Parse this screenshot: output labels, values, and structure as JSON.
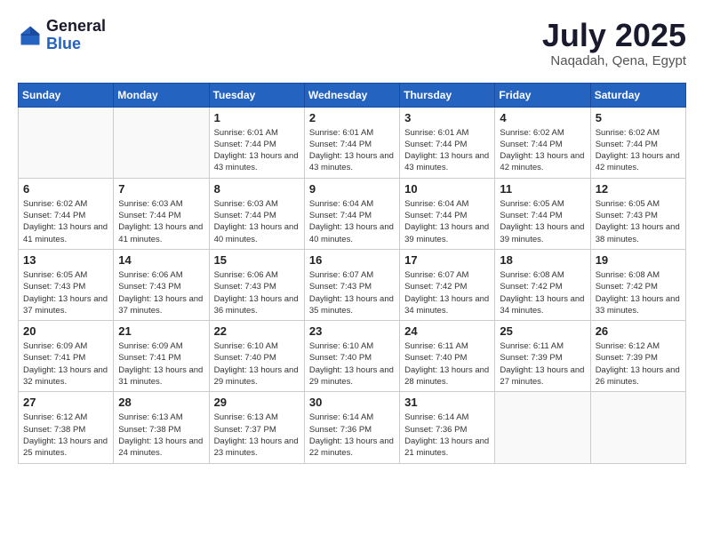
{
  "logo": {
    "general": "General",
    "blue": "Blue"
  },
  "title": "July 2025",
  "location": "Naqadah, Qena, Egypt",
  "weekdays": [
    "Sunday",
    "Monday",
    "Tuesday",
    "Wednesday",
    "Thursday",
    "Friday",
    "Saturday"
  ],
  "weeks": [
    [
      {
        "day": null
      },
      {
        "day": null
      },
      {
        "day": 1,
        "sunrise": "Sunrise: 6:01 AM",
        "sunset": "Sunset: 7:44 PM",
        "daylight": "Daylight: 13 hours and 43 minutes."
      },
      {
        "day": 2,
        "sunrise": "Sunrise: 6:01 AM",
        "sunset": "Sunset: 7:44 PM",
        "daylight": "Daylight: 13 hours and 43 minutes."
      },
      {
        "day": 3,
        "sunrise": "Sunrise: 6:01 AM",
        "sunset": "Sunset: 7:44 PM",
        "daylight": "Daylight: 13 hours and 43 minutes."
      },
      {
        "day": 4,
        "sunrise": "Sunrise: 6:02 AM",
        "sunset": "Sunset: 7:44 PM",
        "daylight": "Daylight: 13 hours and 42 minutes."
      },
      {
        "day": 5,
        "sunrise": "Sunrise: 6:02 AM",
        "sunset": "Sunset: 7:44 PM",
        "daylight": "Daylight: 13 hours and 42 minutes."
      }
    ],
    [
      {
        "day": 6,
        "sunrise": "Sunrise: 6:02 AM",
        "sunset": "Sunset: 7:44 PM",
        "daylight": "Daylight: 13 hours and 41 minutes."
      },
      {
        "day": 7,
        "sunrise": "Sunrise: 6:03 AM",
        "sunset": "Sunset: 7:44 PM",
        "daylight": "Daylight: 13 hours and 41 minutes."
      },
      {
        "day": 8,
        "sunrise": "Sunrise: 6:03 AM",
        "sunset": "Sunset: 7:44 PM",
        "daylight": "Daylight: 13 hours and 40 minutes."
      },
      {
        "day": 9,
        "sunrise": "Sunrise: 6:04 AM",
        "sunset": "Sunset: 7:44 PM",
        "daylight": "Daylight: 13 hours and 40 minutes."
      },
      {
        "day": 10,
        "sunrise": "Sunrise: 6:04 AM",
        "sunset": "Sunset: 7:44 PM",
        "daylight": "Daylight: 13 hours and 39 minutes."
      },
      {
        "day": 11,
        "sunrise": "Sunrise: 6:05 AM",
        "sunset": "Sunset: 7:44 PM",
        "daylight": "Daylight: 13 hours and 39 minutes."
      },
      {
        "day": 12,
        "sunrise": "Sunrise: 6:05 AM",
        "sunset": "Sunset: 7:43 PM",
        "daylight": "Daylight: 13 hours and 38 minutes."
      }
    ],
    [
      {
        "day": 13,
        "sunrise": "Sunrise: 6:05 AM",
        "sunset": "Sunset: 7:43 PM",
        "daylight": "Daylight: 13 hours and 37 minutes."
      },
      {
        "day": 14,
        "sunrise": "Sunrise: 6:06 AM",
        "sunset": "Sunset: 7:43 PM",
        "daylight": "Daylight: 13 hours and 37 minutes."
      },
      {
        "day": 15,
        "sunrise": "Sunrise: 6:06 AM",
        "sunset": "Sunset: 7:43 PM",
        "daylight": "Daylight: 13 hours and 36 minutes."
      },
      {
        "day": 16,
        "sunrise": "Sunrise: 6:07 AM",
        "sunset": "Sunset: 7:43 PM",
        "daylight": "Daylight: 13 hours and 35 minutes."
      },
      {
        "day": 17,
        "sunrise": "Sunrise: 6:07 AM",
        "sunset": "Sunset: 7:42 PM",
        "daylight": "Daylight: 13 hours and 34 minutes."
      },
      {
        "day": 18,
        "sunrise": "Sunrise: 6:08 AM",
        "sunset": "Sunset: 7:42 PM",
        "daylight": "Daylight: 13 hours and 34 minutes."
      },
      {
        "day": 19,
        "sunrise": "Sunrise: 6:08 AM",
        "sunset": "Sunset: 7:42 PM",
        "daylight": "Daylight: 13 hours and 33 minutes."
      }
    ],
    [
      {
        "day": 20,
        "sunrise": "Sunrise: 6:09 AM",
        "sunset": "Sunset: 7:41 PM",
        "daylight": "Daylight: 13 hours and 32 minutes."
      },
      {
        "day": 21,
        "sunrise": "Sunrise: 6:09 AM",
        "sunset": "Sunset: 7:41 PM",
        "daylight": "Daylight: 13 hours and 31 minutes."
      },
      {
        "day": 22,
        "sunrise": "Sunrise: 6:10 AM",
        "sunset": "Sunset: 7:40 PM",
        "daylight": "Daylight: 13 hours and 29 minutes."
      },
      {
        "day": 23,
        "sunrise": "Sunrise: 6:10 AM",
        "sunset": "Sunset: 7:40 PM",
        "daylight": "Daylight: 13 hours and 29 minutes."
      },
      {
        "day": 24,
        "sunrise": "Sunrise: 6:11 AM",
        "sunset": "Sunset: 7:40 PM",
        "daylight": "Daylight: 13 hours and 28 minutes."
      },
      {
        "day": 25,
        "sunrise": "Sunrise: 6:11 AM",
        "sunset": "Sunset: 7:39 PM",
        "daylight": "Daylight: 13 hours and 27 minutes."
      },
      {
        "day": 26,
        "sunrise": "Sunrise: 6:12 AM",
        "sunset": "Sunset: 7:39 PM",
        "daylight": "Daylight: 13 hours and 26 minutes."
      }
    ],
    [
      {
        "day": 27,
        "sunrise": "Sunrise: 6:12 AM",
        "sunset": "Sunset: 7:38 PM",
        "daylight": "Daylight: 13 hours and 25 minutes."
      },
      {
        "day": 28,
        "sunrise": "Sunrise: 6:13 AM",
        "sunset": "Sunset: 7:38 PM",
        "daylight": "Daylight: 13 hours and 24 minutes."
      },
      {
        "day": 29,
        "sunrise": "Sunrise: 6:13 AM",
        "sunset": "Sunset: 7:37 PM",
        "daylight": "Daylight: 13 hours and 23 minutes."
      },
      {
        "day": 30,
        "sunrise": "Sunrise: 6:14 AM",
        "sunset": "Sunset: 7:36 PM",
        "daylight": "Daylight: 13 hours and 22 minutes."
      },
      {
        "day": 31,
        "sunrise": "Sunrise: 6:14 AM",
        "sunset": "Sunset: 7:36 PM",
        "daylight": "Daylight: 13 hours and 21 minutes."
      },
      {
        "day": null
      },
      {
        "day": null
      }
    ]
  ]
}
